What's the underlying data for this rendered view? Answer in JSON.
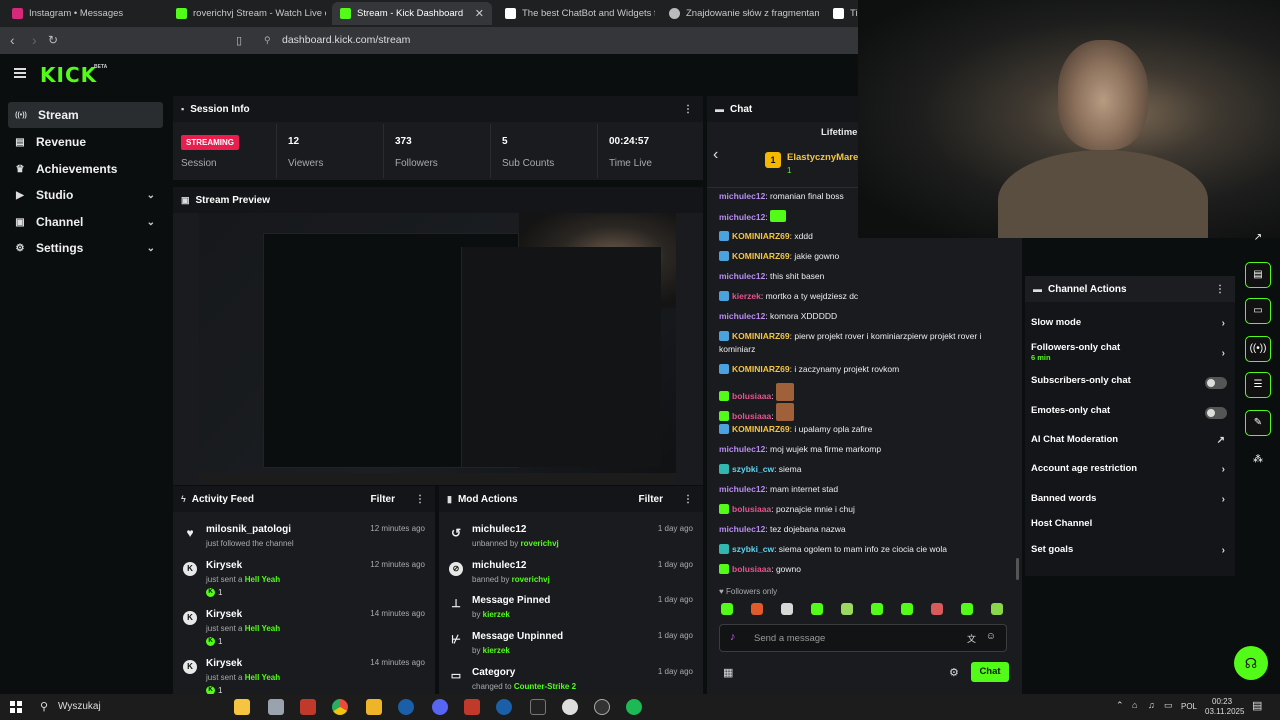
{
  "browser": {
    "tabs": [
      {
        "title": "Instagram • Messages",
        "color": "#d6297a"
      },
      {
        "title": "roverichvj Stream - Watch Live on Kic",
        "color": "#53fc18"
      },
      {
        "title": "Stream - Kick Dashboard",
        "color": "#53fc18"
      },
      {
        "title": "The best ChatBot and Widgets for Kic",
        "color": "#ffffff"
      },
      {
        "title": "Znajdowanie słów z fragmentami",
        "color": "#bbbbbb"
      },
      {
        "title": "Tip",
        "color": "#ffffff"
      }
    ],
    "url": "dashboard.kick.com/stream"
  },
  "logo": {
    "text": "KICK",
    "beta": "BETA"
  },
  "sidebar": {
    "items": [
      {
        "label": "Stream",
        "icon": "stream-icon",
        "glyph": "((•))"
      },
      {
        "label": "Revenue",
        "icon": "revenue-icon",
        "glyph": "▤"
      },
      {
        "label": "Achievements",
        "icon": "trophy-icon",
        "glyph": "♛"
      },
      {
        "label": "Studio",
        "icon": "studio-icon",
        "glyph": "▶"
      },
      {
        "label": "Channel",
        "icon": "channel-icon",
        "glyph": "▣"
      },
      {
        "label": "Settings",
        "icon": "gear-icon",
        "glyph": "⚙"
      }
    ]
  },
  "session_info": {
    "title": "Session Info",
    "status_badge": "STREAMING",
    "status_label": "Session",
    "stats": [
      {
        "value": "12",
        "label": "Viewers"
      },
      {
        "value": "373",
        "label": "Followers"
      },
      {
        "value": "5",
        "label": "Sub Counts"
      },
      {
        "value": "00:24:57",
        "label": "Time Live"
      }
    ]
  },
  "stream_preview": {
    "title": "Stream Preview"
  },
  "activity_feed": {
    "title": "Activity Feed",
    "filter": "Filter",
    "items": [
      {
        "user": "milosnik_patologi",
        "desc": "just followed the channel",
        "highlight": "",
        "count": "",
        "time": "12 minutes ago"
      },
      {
        "user": "Kirysek",
        "desc": "just sent a ",
        "highlight": "Hell Yeah",
        "count": "1",
        "time": "12 minutes ago"
      },
      {
        "user": "Kirysek",
        "desc": "just sent a ",
        "highlight": "Hell Yeah",
        "count": "1",
        "time": "14 minutes ago"
      },
      {
        "user": "Kirysek",
        "desc": "just sent a ",
        "highlight": "Hell Yeah",
        "count": "1",
        "time": "14 minutes ago"
      }
    ]
  },
  "mod_actions": {
    "title": "Mod Actions",
    "filter": "Filter",
    "items": [
      {
        "title": "michulec12",
        "desc": "unbanned by ",
        "by": "roverichvj",
        "time": "1 day ago"
      },
      {
        "title": "michulec12",
        "desc": "banned by ",
        "by": "roverichvj",
        "time": "1 day ago"
      },
      {
        "title": "Message Pinned",
        "desc": "by ",
        "by": "kierzek",
        "time": "1 day ago"
      },
      {
        "title": "Message Unpinned",
        "desc": "by ",
        "by": "kierzek",
        "time": "1 day ago"
      },
      {
        "title": "Category",
        "desc": "changed to ",
        "by": "Counter-Strike 2",
        "time": "1 day ago"
      }
    ]
  },
  "chat": {
    "title": "Chat",
    "lifetime": "Lifetime",
    "top_user": "ElastycznyMare",
    "top_rank": "1",
    "top_count": "1",
    "messages": [
      {
        "user": "michulec12",
        "color": "#b98cf5",
        "text": "romanian final boss",
        "badge": ""
      },
      {
        "user": "michulec12",
        "color": "#b98cf5",
        "text": "",
        "badge": "emote"
      },
      {
        "user": "KOMINIARZ69",
        "color": "#f5c542",
        "text": "xddd",
        "badge": "#4aa3df"
      },
      {
        "user": "KOMINIARZ69",
        "color": "#f5c542",
        "text": "jakie gowno",
        "badge": "#4aa3df"
      },
      {
        "user": "michulec12",
        "color": "#b98cf5",
        "text": "this shit basen",
        "badge": ""
      },
      {
        "user": "kierzek",
        "color": "#e8538f",
        "text": "mortko a ty wejdziesz dc",
        "badge": "#4aa3df"
      },
      {
        "user": "michulec12",
        "color": "#b98cf5",
        "text": "komora XDDDDD",
        "badge": ""
      },
      {
        "user": "KOMINIARZ69",
        "color": "#f5c542",
        "text": "pierw projekt rover i kominiarzpierw projekt rover i kominiarz",
        "badge": "#4aa3df"
      },
      {
        "user": "KOMINIARZ69",
        "color": "#f5c542",
        "text": "i zaczynamy projekt rovkom",
        "badge": "#4aa3df"
      },
      {
        "user": "bolusiaaa",
        "color": "#e8538f",
        "text": "",
        "badge": "#53fc18"
      },
      {
        "user": "bolusiaaa",
        "color": "#e8538f",
        "text": "",
        "badge": "#53fc18"
      },
      {
        "user": "KOMINIARZ69",
        "color": "#f5c542",
        "text": "i upalamy opla zafire",
        "badge": "#4aa3df"
      },
      {
        "user": "michulec12",
        "color": "#b98cf5",
        "text": "moj wujek ma firme markomp",
        "badge": ""
      },
      {
        "user": "szybki_cw",
        "color": "#5fd3f0",
        "text": "siema",
        "badge": "#2fb7b0"
      },
      {
        "user": "michulec12",
        "color": "#b98cf5",
        "text": "mam internet stad",
        "badge": ""
      },
      {
        "user": "bolusiaaa",
        "color": "#e8538f",
        "text": "poznajcie mnie i chuj",
        "badge": "#53fc18"
      },
      {
        "user": "michulec12",
        "color": "#b98cf5",
        "text": "tez dojebana nazwa",
        "badge": ""
      },
      {
        "user": "szybki_cw",
        "color": "#5fd3f0",
        "text": "siema ogolem to mam info ze ciocia cie wola",
        "badge": "#2fb7b0"
      },
      {
        "user": "bolusiaaa",
        "color": "#e8538f",
        "text": "gowno",
        "badge": "#53fc18"
      }
    ],
    "followers_only": "Followers only",
    "placeholder": "Send a message",
    "send_label": "Chat"
  },
  "channel_actions": {
    "title": "Channel Actions",
    "items": [
      {
        "label": "Slow mode",
        "sub": "",
        "control": "chevron"
      },
      {
        "label": "Followers-only chat",
        "sub": "6 min",
        "control": "chevron"
      },
      {
        "label": "Subscribers-only chat",
        "sub": "",
        "control": "toggle"
      },
      {
        "label": "Emotes-only chat",
        "sub": "",
        "control": "toggle"
      },
      {
        "label": "AI Chat Moderation",
        "sub": "",
        "control": "external"
      },
      {
        "label": "Account age restriction",
        "sub": "",
        "control": "chevron"
      },
      {
        "label": "Banned words",
        "sub": "",
        "control": "chevron"
      },
      {
        "label": "Host Channel",
        "sub": "",
        "control": ""
      },
      {
        "label": "Set goals",
        "sub": "",
        "control": "chevron"
      }
    ]
  },
  "taskbar": {
    "search": "Wyszukaj",
    "lang": "POL",
    "time": "00:23",
    "date": "03.11.2025"
  }
}
